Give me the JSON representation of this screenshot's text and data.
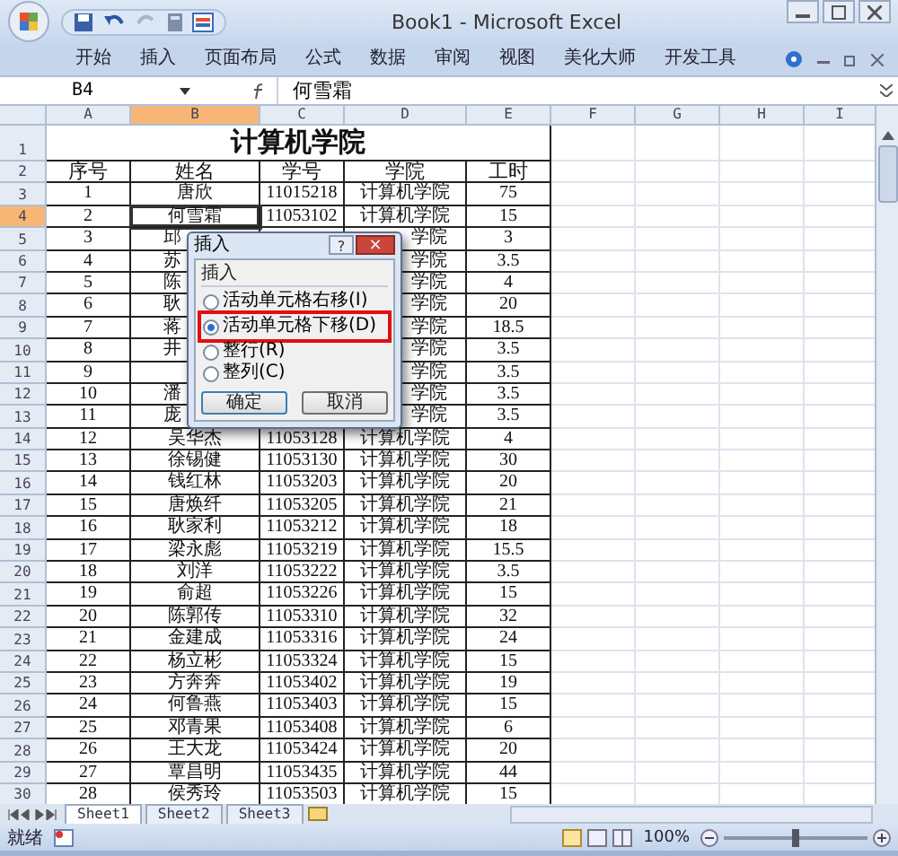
{
  "window": {
    "title": "Book1 - Microsoft Excel"
  },
  "ribbon_tabs": [
    "开始",
    "插入",
    "页面布局",
    "公式",
    "数据",
    "审阅",
    "视图",
    "美化大师",
    "开发工具"
  ],
  "name_box": "B4",
  "formula": "何雪霜",
  "columns": [
    {
      "label": "A",
      "selected": false
    },
    {
      "label": "B",
      "selected": true
    },
    {
      "label": "C",
      "selected": false
    },
    {
      "label": "D",
      "selected": false
    },
    {
      "label": "E",
      "selected": false
    },
    {
      "label": "F",
      "selected": false
    },
    {
      "label": "G",
      "selected": false
    },
    {
      "label": "H",
      "selected": false
    },
    {
      "label": "I",
      "selected": false
    }
  ],
  "rows": [
    {
      "header": "1",
      "selected": false,
      "kind": "title",
      "title": "计算机学院"
    },
    {
      "header": "2",
      "selected": false,
      "kind": "heading",
      "a": "序号",
      "b": "姓名",
      "c": "学号",
      "d": "学院",
      "e": "工时"
    },
    {
      "header": "3",
      "selected": false,
      "kind": "data",
      "a": "1",
      "b": "唐欣",
      "c": "11015218",
      "d": "计算机学院",
      "e": "75"
    },
    {
      "header": "4",
      "selected": true,
      "kind": "data",
      "a": "2",
      "b": "何雪霜",
      "c": "11053102",
      "d": "计算机学院",
      "e": "15"
    },
    {
      "header": "5",
      "selected": false,
      "kind": "covered",
      "a": "3",
      "b": "邱",
      "d": "学院",
      "e": "3"
    },
    {
      "header": "6",
      "selected": false,
      "kind": "covered",
      "a": "4",
      "b": "苏",
      "d": "学院",
      "e": "3.5"
    },
    {
      "header": "7",
      "selected": false,
      "kind": "covered",
      "a": "5",
      "b": "陈",
      "d": "学院",
      "e": "4"
    },
    {
      "header": "8",
      "selected": false,
      "kind": "covered",
      "a": "6",
      "b": "耿",
      "d": "学院",
      "e": "20"
    },
    {
      "header": "9",
      "selected": false,
      "kind": "covered",
      "a": "7",
      "b": "蒋",
      "d": "学院",
      "e": "18.5"
    },
    {
      "header": "10",
      "selected": false,
      "kind": "covered",
      "a": "8",
      "b": "井",
      "d": "学院",
      "e": "3.5"
    },
    {
      "header": "11",
      "selected": false,
      "kind": "covered",
      "a": "9",
      "d": "学院",
      "e": "3.5"
    },
    {
      "header": "12",
      "selected": false,
      "kind": "covered",
      "a": "10",
      "b": "潘",
      "d": "学院",
      "e": "3.5"
    },
    {
      "header": "13",
      "selected": false,
      "kind": "covered",
      "a": "11",
      "b": "庞",
      "d": "学院",
      "e": "3.5"
    },
    {
      "header": "14",
      "selected": false,
      "kind": "data",
      "a": "12",
      "b": "吴华杰",
      "c": "11053128",
      "d": "计算机学院",
      "e": "4"
    },
    {
      "header": "15",
      "selected": false,
      "kind": "data",
      "a": "13",
      "b": "徐锡健",
      "c": "11053130",
      "d": "计算机学院",
      "e": "30"
    },
    {
      "header": "16",
      "selected": false,
      "kind": "data",
      "a": "14",
      "b": "钱红林",
      "c": "11053203",
      "d": "计算机学院",
      "e": "20"
    },
    {
      "header": "17",
      "selected": false,
      "kind": "data",
      "a": "15",
      "b": "唐焕纤",
      "c": "11053205",
      "d": "计算机学院",
      "e": "21"
    },
    {
      "header": "18",
      "selected": false,
      "kind": "data",
      "a": "16",
      "b": "耿家利",
      "c": "11053212",
      "d": "计算机学院",
      "e": "18"
    },
    {
      "header": "19",
      "selected": false,
      "kind": "data",
      "a": "17",
      "b": "梁永彪",
      "c": "11053219",
      "d": "计算机学院",
      "e": "15.5"
    },
    {
      "header": "20",
      "selected": false,
      "kind": "data",
      "a": "18",
      "b": "刘洋",
      "c": "11053222",
      "d": "计算机学院",
      "e": "3.5"
    },
    {
      "header": "21",
      "selected": false,
      "kind": "data",
      "a": "19",
      "b": "俞超",
      "c": "11053226",
      "d": "计算机学院",
      "e": "15"
    },
    {
      "header": "22",
      "selected": false,
      "kind": "data",
      "a": "20",
      "b": "陈郭传",
      "c": "11053310",
      "d": "计算机学院",
      "e": "32"
    },
    {
      "header": "23",
      "selected": false,
      "kind": "data",
      "a": "21",
      "b": "金建成",
      "c": "11053316",
      "d": "计算机学院",
      "e": "24"
    },
    {
      "header": "24",
      "selected": false,
      "kind": "data",
      "a": "22",
      "b": "杨立彬",
      "c": "11053324",
      "d": "计算机学院",
      "e": "15"
    },
    {
      "header": "25",
      "selected": false,
      "kind": "data",
      "a": "23",
      "b": "方奔奔",
      "c": "11053402",
      "d": "计算机学院",
      "e": "19"
    },
    {
      "header": "26",
      "selected": false,
      "kind": "data",
      "a": "24",
      "b": "何鲁燕",
      "c": "11053403",
      "d": "计算机学院",
      "e": "15"
    },
    {
      "header": "27",
      "selected": false,
      "kind": "data",
      "a": "25",
      "b": "邓青果",
      "c": "11053408",
      "d": "计算机学院",
      "e": "6"
    },
    {
      "header": "28",
      "selected": false,
      "kind": "data",
      "a": "26",
      "b": "王大龙",
      "c": "11053424",
      "d": "计算机学院",
      "e": "20"
    },
    {
      "header": "29",
      "selected": false,
      "kind": "data",
      "a": "27",
      "b": "覃昌明",
      "c": "11053435",
      "d": "计算机学院",
      "e": "44"
    },
    {
      "header": "30",
      "selected": false,
      "kind": "data",
      "a": "28",
      "b": "侯秀玲",
      "c": "11053503",
      "d": "计算机学院",
      "e": "15"
    }
  ],
  "dialog": {
    "title": "插入",
    "help": "?",
    "close": "×",
    "group": "插入",
    "options": [
      {
        "label": "活动单元格右移(I)",
        "selected": false,
        "highlighted": false
      },
      {
        "label": "活动单元格下移(D)",
        "selected": true,
        "highlighted": true
      },
      {
        "label": "整行(R)",
        "selected": false,
        "highlighted": false
      },
      {
        "label": "整列(C)",
        "selected": false,
        "highlighted": false
      }
    ],
    "buttons": [
      "确定",
      "取消"
    ]
  },
  "sheet_tabs": [
    {
      "label": "Sheet1",
      "selected": true
    },
    {
      "label": "Sheet2",
      "selected": false
    },
    {
      "label": "Sheet3",
      "selected": false
    }
  ],
  "status_bar": {
    "status": "就绪",
    "zoom": "100%",
    "zoom_slider": {
      "level": 0.5
    }
  }
}
